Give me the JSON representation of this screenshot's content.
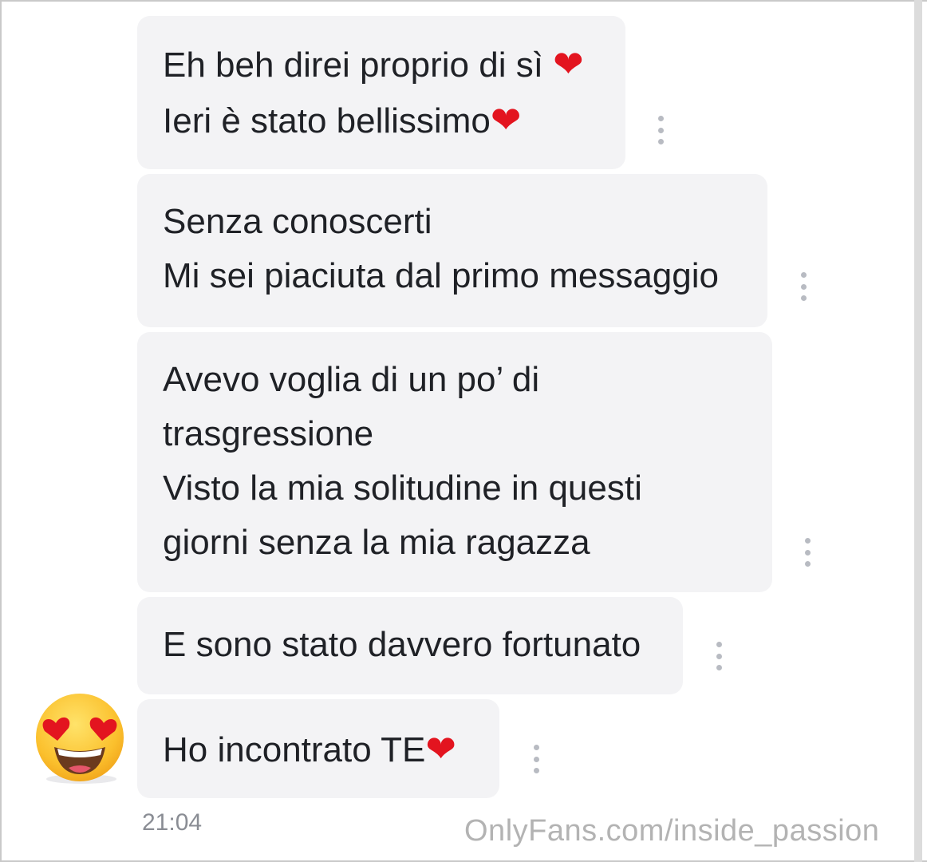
{
  "messages": [
    {
      "lines": [
        "Eh beh direi proprio di sì",
        "Ieri è stato bellissimo"
      ],
      "heart": "❤"
    },
    {
      "lines": [
        "Senza conoscerti",
        "Mi sei piaciuta dal primo messaggio"
      ]
    },
    {
      "lines": [
        "Avevo voglia di un po’ di",
        "trasgressione",
        "Visto la mia solitudine in questi",
        "giorni senza la mia ragazza"
      ]
    },
    {
      "lines": [
        "E sono stato davvero fortunato"
      ]
    },
    {
      "lines": [
        "Ho incontrato TE"
      ],
      "heart": "❤"
    }
  ],
  "timestamp": "21:04",
  "avatar_icon": "heart-eyes-emoji-icon",
  "more_icon": "more-vertical-icon",
  "watermark": "OnlyFans.com/inside_passion",
  "colors": {
    "bubble_bg": "#f3f3f5",
    "text": "#1f2126",
    "heart": "#e3141f",
    "muted": "#8a8d94"
  }
}
